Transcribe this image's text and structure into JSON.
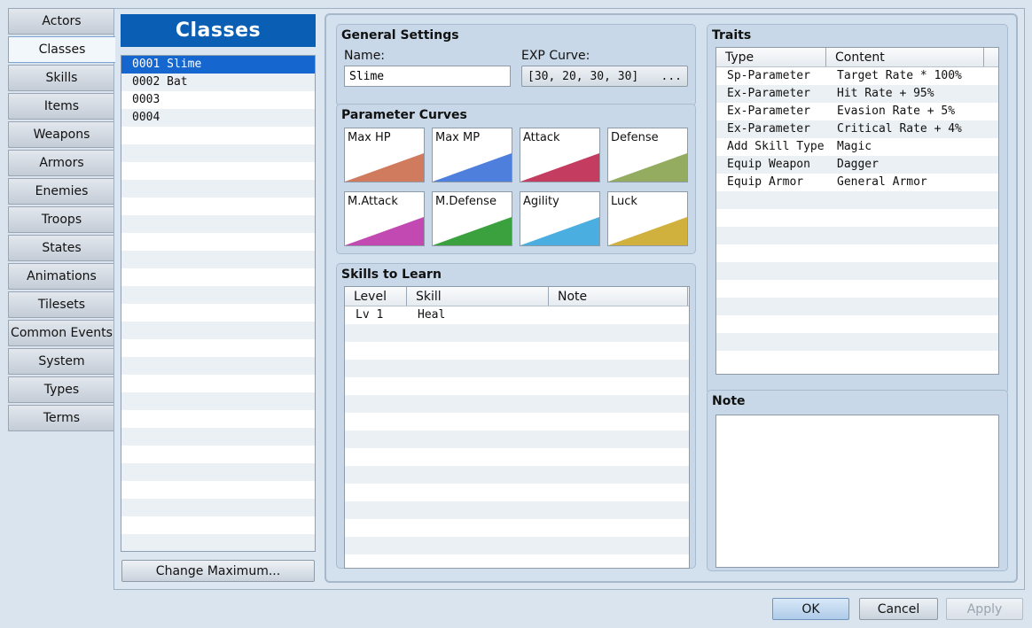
{
  "tabs": [
    "Actors",
    "Classes",
    "Skills",
    "Items",
    "Weapons",
    "Armors",
    "Enemies",
    "Troops",
    "States",
    "Animations",
    "Tilesets",
    "Common Events",
    "System",
    "Types",
    "Terms"
  ],
  "active_tab": "Classes",
  "list": {
    "title": "Classes",
    "items": [
      "0001 Slime",
      "0002 Bat",
      "0003",
      "0004"
    ],
    "selected_index": 0,
    "change_max_label": "Change Maximum..."
  },
  "general": {
    "title": "General Settings",
    "name_label": "Name:",
    "name_value": "Slime",
    "exp_label": "EXP Curve:",
    "exp_value": "[30, 20, 30, 30]",
    "exp_button": "..."
  },
  "curves": {
    "title": "Parameter Curves",
    "items": [
      {
        "name": "Max HP",
        "color": "#d07a5e"
      },
      {
        "name": "Max MP",
        "color": "#4f7fdd"
      },
      {
        "name": "Attack",
        "color": "#c43c5f"
      },
      {
        "name": "Defense",
        "color": "#93ac60"
      },
      {
        "name": "M.Attack",
        "color": "#c249b2"
      },
      {
        "name": "M.Defense",
        "color": "#3aa13e"
      },
      {
        "name": "Agility",
        "color": "#4aaee0"
      },
      {
        "name": "Luck",
        "color": "#d1b13e"
      }
    ]
  },
  "skills": {
    "title": "Skills to Learn",
    "headers": [
      "Level",
      "Skill",
      "Note"
    ],
    "rows": [
      [
        "Lv  1",
        "Heal",
        ""
      ]
    ]
  },
  "traits": {
    "title": "Traits",
    "headers": [
      "Type",
      "Content"
    ],
    "rows": [
      [
        "Sp-Parameter",
        "Target Rate * 100%"
      ],
      [
        "Ex-Parameter",
        "Hit Rate + 95%"
      ],
      [
        "Ex-Parameter",
        "Evasion Rate + 5%"
      ],
      [
        "Ex-Parameter",
        "Critical Rate + 4%"
      ],
      [
        "Add Skill Type",
        "Magic"
      ],
      [
        "Equip Weapon",
        "Dagger"
      ],
      [
        "Equip Armor",
        "General Armor"
      ]
    ]
  },
  "note": {
    "title": "Note",
    "value": ""
  },
  "buttons": {
    "ok": "OK",
    "cancel": "Cancel",
    "apply": "Apply"
  }
}
